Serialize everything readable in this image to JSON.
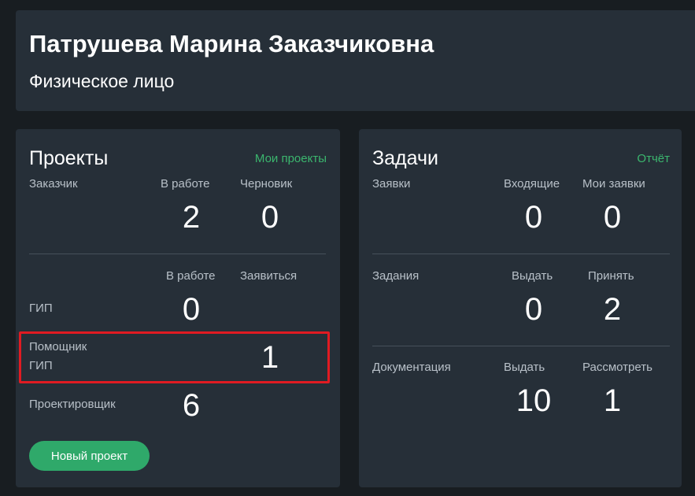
{
  "header": {
    "name": "Патрушева Марина Заказчиковна",
    "type": "Физическое лицо"
  },
  "projects": {
    "title": "Проекты",
    "link": "Мои проекты",
    "customer": {
      "label": "Заказчик",
      "col1": "В работе",
      "col2": "Черновик",
      "val1": "2",
      "val2": "0"
    },
    "cols": {
      "col1": "В работе",
      "col2": "Заявиться"
    },
    "roles": [
      {
        "label": "ГИП",
        "val1": "0",
        "val2": ""
      },
      {
        "label_line1": "Помощник",
        "label_line2": "ГИП",
        "val1": "",
        "val2": "1"
      },
      {
        "label": "Проектировщик",
        "val1": "6",
        "val2": ""
      }
    ],
    "new_button": "Новый проект"
  },
  "tasks": {
    "title": "Задачи",
    "link": "Отчёт",
    "requests": {
      "label": "Заявки",
      "col1": "Входящие",
      "col2": "Мои заявки",
      "val1": "0",
      "val2": "0"
    },
    "assignments": {
      "label": "Задания",
      "col1": "Выдать",
      "col2": "Принять",
      "val1": "0",
      "val2": "2"
    },
    "documentation": {
      "label": "Документация",
      "col1": "Выдать",
      "col2": "Рассмотреть",
      "val1": "10",
      "val2": "1"
    }
  },
  "colors": {
    "background": "#181d21",
    "card": "#262f38",
    "accent": "#3bb66e",
    "button": "#2fa96a",
    "highlight": "#e01b22"
  }
}
